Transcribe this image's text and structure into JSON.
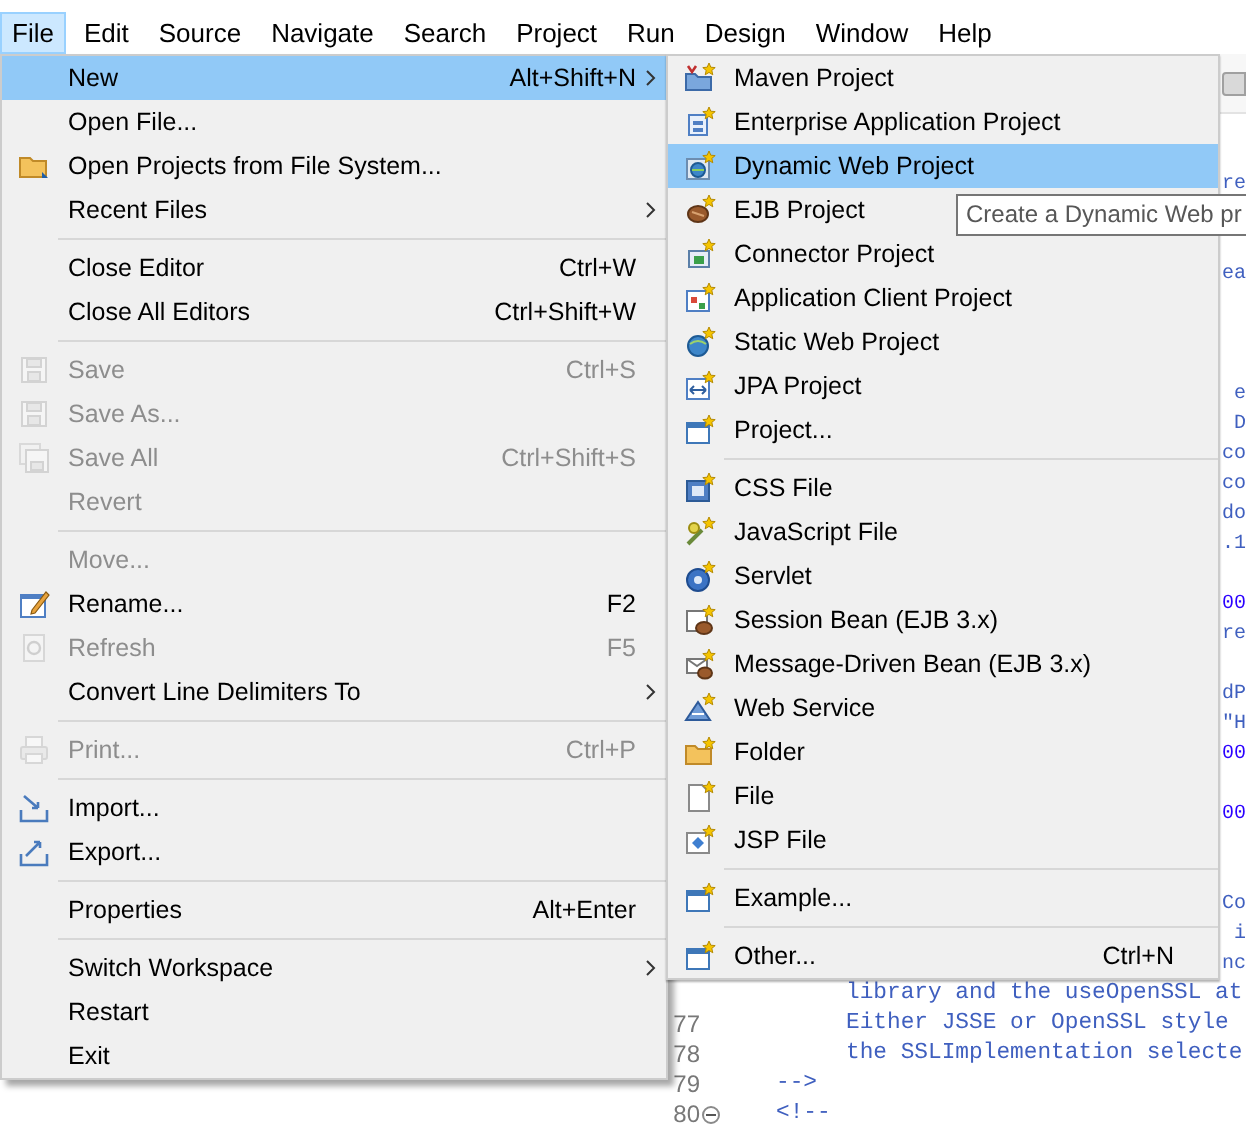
{
  "menubar": [
    {
      "label": "File",
      "selected": true
    },
    {
      "label": "Edit",
      "selected": false
    },
    {
      "label": "Source",
      "selected": false
    },
    {
      "label": "Navigate",
      "selected": false
    },
    {
      "label": "Search",
      "selected": false
    },
    {
      "label": "Project",
      "selected": false
    },
    {
      "label": "Run",
      "selected": false
    },
    {
      "label": "Design",
      "selected": false
    },
    {
      "label": "Window",
      "selected": false
    },
    {
      "label": "Help",
      "selected": false
    }
  ],
  "file_menu": [
    {
      "kind": "item",
      "label": "New",
      "shortcut": "Alt+Shift+N",
      "submenu": true,
      "selected": true,
      "disabled": false
    },
    {
      "kind": "item",
      "label": "Open File...",
      "submenu": false,
      "selected": false,
      "disabled": false
    },
    {
      "kind": "item",
      "label": "Open Projects from File System...",
      "submenu": false,
      "selected": false,
      "disabled": false
    },
    {
      "kind": "item",
      "label": "Recent Files",
      "submenu": true,
      "selected": false,
      "disabled": false
    },
    {
      "kind": "separator"
    },
    {
      "kind": "item",
      "label": "Close Editor",
      "shortcut": "Ctrl+W",
      "submenu": false,
      "selected": false,
      "disabled": false
    },
    {
      "kind": "item",
      "label": "Close All Editors",
      "shortcut": "Ctrl+Shift+W",
      "submenu": false,
      "selected": false,
      "disabled": false
    },
    {
      "kind": "separator"
    },
    {
      "kind": "item",
      "label": "Save",
      "shortcut": "Ctrl+S",
      "submenu": false,
      "selected": false,
      "disabled": true
    },
    {
      "kind": "item",
      "label": "Save As...",
      "submenu": false,
      "selected": false,
      "disabled": true
    },
    {
      "kind": "item",
      "label": "Save All",
      "shortcut": "Ctrl+Shift+S",
      "submenu": false,
      "selected": false,
      "disabled": true
    },
    {
      "kind": "item",
      "label": "Revert",
      "submenu": false,
      "selected": false,
      "disabled": true
    },
    {
      "kind": "separator"
    },
    {
      "kind": "item",
      "label": "Move...",
      "submenu": false,
      "selected": false,
      "disabled": true
    },
    {
      "kind": "item",
      "label": "Rename...",
      "shortcut": "F2",
      "submenu": false,
      "selected": false,
      "disabled": false
    },
    {
      "kind": "item",
      "label": "Refresh",
      "shortcut": "F5",
      "submenu": false,
      "selected": false,
      "disabled": true
    },
    {
      "kind": "item",
      "label": "Convert Line Delimiters To",
      "submenu": true,
      "selected": false,
      "disabled": false
    },
    {
      "kind": "separator"
    },
    {
      "kind": "item",
      "label": "Print...",
      "shortcut": "Ctrl+P",
      "submenu": false,
      "selected": false,
      "disabled": true
    },
    {
      "kind": "separator"
    },
    {
      "kind": "item",
      "label": "Import...",
      "submenu": false,
      "selected": false,
      "disabled": false
    },
    {
      "kind": "item",
      "label": "Export...",
      "submenu": false,
      "selected": false,
      "disabled": false
    },
    {
      "kind": "separator"
    },
    {
      "kind": "item",
      "label": "Properties",
      "shortcut": "Alt+Enter",
      "submenu": false,
      "selected": false,
      "disabled": false
    },
    {
      "kind": "separator"
    },
    {
      "kind": "item",
      "label": "Switch Workspace",
      "submenu": true,
      "selected": false,
      "disabled": false
    },
    {
      "kind": "item",
      "label": "Restart",
      "submenu": false,
      "selected": false,
      "disabled": false
    },
    {
      "kind": "item",
      "label": "Exit",
      "submenu": false,
      "selected": false,
      "disabled": false
    }
  ],
  "new_submenu": [
    {
      "kind": "item",
      "label": "Maven Project",
      "selected": false
    },
    {
      "kind": "item",
      "label": "Enterprise Application Project",
      "selected": false
    },
    {
      "kind": "item",
      "label": "Dynamic Web Project",
      "selected": true
    },
    {
      "kind": "item",
      "label": "EJB Project",
      "selected": false
    },
    {
      "kind": "item",
      "label": "Connector Project",
      "selected": false
    },
    {
      "kind": "item",
      "label": "Application Client Project",
      "selected": false
    },
    {
      "kind": "item",
      "label": "Static Web Project",
      "selected": false
    },
    {
      "kind": "item",
      "label": "JPA Project",
      "selected": false
    },
    {
      "kind": "item",
      "label": "Project...",
      "selected": false
    },
    {
      "kind": "separator"
    },
    {
      "kind": "item",
      "label": "CSS File",
      "selected": false
    },
    {
      "kind": "item",
      "label": "JavaScript File",
      "selected": false
    },
    {
      "kind": "item",
      "label": "Servlet",
      "selected": false
    },
    {
      "kind": "item",
      "label": "Session Bean (EJB 3.x)",
      "selected": false
    },
    {
      "kind": "item",
      "label": "Message-Driven Bean (EJB 3.x)",
      "selected": false
    },
    {
      "kind": "item",
      "label": "Web Service",
      "selected": false
    },
    {
      "kind": "item",
      "label": "Folder",
      "selected": false
    },
    {
      "kind": "item",
      "label": "File",
      "selected": false
    },
    {
      "kind": "item",
      "label": "JSP File",
      "selected": false
    },
    {
      "kind": "separator"
    },
    {
      "kind": "item",
      "label": "Example...",
      "selected": false
    },
    {
      "kind": "separator"
    },
    {
      "kind": "item",
      "label": "Other...",
      "shortcut": "Ctrl+N",
      "selected": false
    }
  ],
  "tooltip": "Create a Dynamic Web pr",
  "editor": {
    "lines": [
      {
        "kind": "tail",
        "text": "re",
        "color": "#3f5fbf"
      },
      {
        "kind": "blank"
      },
      {
        "kind": "blank"
      },
      {
        "kind": "tail",
        "text": "ea",
        "color": "#3f5fbf"
      },
      {
        "kind": "blank"
      },
      {
        "kind": "blank"
      },
      {
        "kind": "blank"
      },
      {
        "kind": "tail",
        "text": "e",
        "color": "#3f5fbf"
      },
      {
        "kind": "tail",
        "text": "D",
        "color": "#3f5fbf"
      },
      {
        "kind": "tail",
        "text": "co",
        "color": "#3f5fbf"
      },
      {
        "kind": "tail",
        "text": "co",
        "color": "#3f5fbf"
      },
      {
        "kind": "tail",
        "text": "do",
        "color": "#3f5fbf"
      },
      {
        "kind": "tail",
        "text": ".1",
        "color": "#3f5fbf"
      },
      {
        "kind": "blank"
      },
      {
        "kind": "tail",
        "text": "00",
        "color": "#2a00ff"
      },
      {
        "kind": "tail",
        "text": "re",
        "color": "#3f5fbf"
      },
      {
        "kind": "blank"
      },
      {
        "kind": "tail",
        "text": "dP",
        "color": "#3f5fbf"
      },
      {
        "kind": "tail",
        "text": "\"H",
        "color": "#3f5fbf"
      },
      {
        "kind": "tail",
        "text": "00",
        "color": "#2a00ff"
      },
      {
        "kind": "blank"
      },
      {
        "kind": "tail",
        "text": "00",
        "color": "#2a00ff"
      },
      {
        "kind": "blank"
      },
      {
        "kind": "blank"
      },
      {
        "kind": "tail",
        "text": "Co",
        "color": "#3f5fbf"
      },
      {
        "kind": "tail",
        "text": "i",
        "color": "#3f5fbf"
      },
      {
        "kind": "tail",
        "text": "nc",
        "color": "#3f5fbf"
      },
      {
        "kind": "body",
        "text": "library and the useOpenSSL at",
        "color": "#3f5fbf"
      },
      {
        "kind": "body",
        "number": "77",
        "text": "Either JSSE or OpenSSL style",
        "color": "#3f5fbf"
      },
      {
        "kind": "body",
        "number": "78",
        "text": "the SSLImplementation selecte",
        "color": "#3f5fbf"
      },
      {
        "kind": "marker",
        "number": "79",
        "text": "-->",
        "color": "#3f5fbf"
      },
      {
        "kind": "marker",
        "number": "80",
        "folded": false,
        "text": "<!--",
        "color": "#3f5fbf"
      }
    ]
  }
}
